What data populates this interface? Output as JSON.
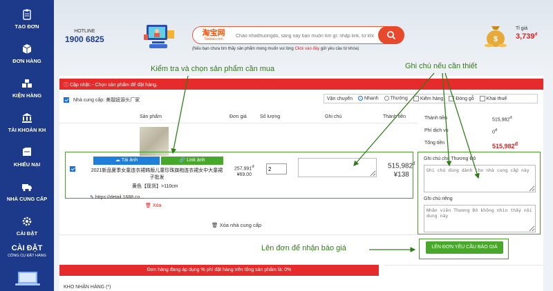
{
  "sidebar": {
    "items": [
      {
        "label": "TẠO ĐƠN",
        "icon": "clipboard-icon"
      },
      {
        "label": "ĐƠN HÀNG",
        "icon": "box-icon"
      },
      {
        "label": "KIỆN HÀNG",
        "icon": "packages-icon"
      },
      {
        "label": "TÀI KHOẢN KH",
        "icon": "bank-icon"
      },
      {
        "label": "KHIẾU NẠI",
        "icon": "complaint-icon"
      },
      {
        "label": "NHÀ CUNG CẤP",
        "icon": "truck-icon"
      },
      {
        "label": "CÀI ĐẶT",
        "icon": "gear-icon"
      }
    ],
    "setting_title": "CÀI ĐẶT",
    "setting_subtitle": "CÔNG CỤ ĐẶT HÀNG"
  },
  "header": {
    "hotline_label": "HOTLINE",
    "hotline_number": "1900 6825",
    "logo_cn": "淘宝网",
    "logo_en": "Taobao.com",
    "search_placeholder": "Chào nhatthuongdo, sáng nay bạn muốn tìm gì: nhập link, từ khóa",
    "hint_prefix": "(Nếu bạn chưa tìm thấy sản phẩm mong muốn vui lòng ",
    "hint_link": "Click vào đây",
    "hint_suffix": " gửi yêu cầu từ khóa)",
    "rate_label": "Tỉ giá",
    "rate_value": "3,739",
    "rate_unit": "đ"
  },
  "cart": {
    "alert": "Cập nhật: - Chọn sản phẩm để đặt hàng.",
    "supplier_label": "Nhà cung cấp: 美靓妞源头厂家",
    "options": {
      "shipping_label": "Vận chuyển",
      "fast": "Nhanh",
      "normal": "Thường",
      "inspect": "Kiểm hàng",
      "wood": "Đóng gỗ",
      "declare": "Khai thuế"
    },
    "columns": {
      "product": "Sản phẩm",
      "unit_price": "Đơn giá",
      "quantity": "Số lượng",
      "note": "Ghi chú",
      "total": "Thành tiền"
    },
    "item": {
      "btn_image": "Tải ảnh",
      "btn_link": "Link ảnh",
      "name": "2021新品夏季女童连衣裙韩版儿童珍珠旗袍连衣裙女中大童裙子批发",
      "variant": "黄色【现货】>110cm",
      "price_vnd": "257,991",
      "price_unit": "đ",
      "price_cny": "¥69.00",
      "quantity": "2",
      "total_vnd": "515,982",
      "total_unit": "đ",
      "total_cny": "¥138",
      "url": "https://detail.1688.co...",
      "remove": "Xóa"
    },
    "remove_supplier": "Xóa nhà cung cấp",
    "summary": {
      "subtotal_label": "Thành tiền",
      "subtotal_value": "515,982",
      "service_label": "Phí dịch vụ",
      "service_value": "0",
      "total_label": "Tổng tiền",
      "total_value": "515,982",
      "unit": "đ"
    },
    "note_supplier_label": "Ghi chú cho Thương Đô",
    "note_supplier_placeholder": "Ghi chú dùng dành cho nhà cung cấp này",
    "note_private_label": "Ghi chú riêng",
    "note_private_placeholder": "Nhân viên Thương Đô không nhìn thấy nội dung này",
    "order_button": "LÊN ĐƠN YÊU CẦU BÁO GIÁ",
    "fee_banner": "Đơn hàng đang áp dụng % phí đặt hàng trên tổng sản phẩm là: 0%",
    "warehouse_label": "KHO NHẬN HÀNG (*)"
  },
  "annotations": {
    "check_products": "Kiểm tra và chọn sản phẩm cần mua",
    "note_if_needed": "Ghi chú nếu cần thiết",
    "place_order": "Lên đơn để nhận báo giá"
  },
  "colors": {
    "sidebar": "#1d3a8a",
    "alert": "#e52b2b",
    "accent_green": "#49a82c",
    "annotation_green": "#2e7d17",
    "price_red": "#e02020"
  }
}
